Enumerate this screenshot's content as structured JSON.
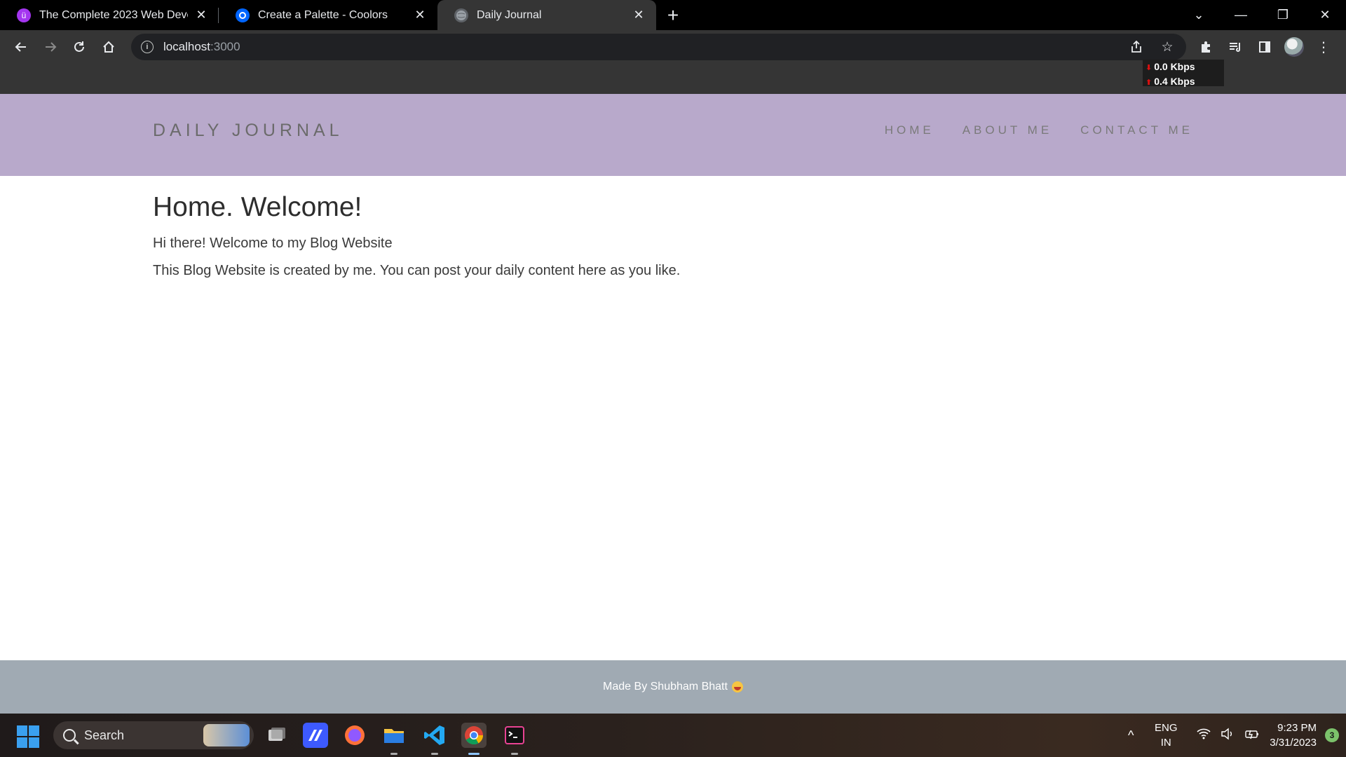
{
  "browser": {
    "tabs": [
      {
        "title": "The Complete 2023 Web Develop",
        "icon": "udemy-icon",
        "active": false
      },
      {
        "title": "Create a Palette - Coolors",
        "icon": "coolors-icon",
        "active": false
      },
      {
        "title": "Daily Journal",
        "icon": "globe-icon",
        "active": true
      }
    ],
    "new_tab_label": "+",
    "address": {
      "host": "localhost",
      "port": ":3000"
    },
    "net_meter": {
      "down": "0.0 Kbps",
      "up": "0.4 Kbps"
    }
  },
  "site": {
    "brand": "DAILY JOURNAL",
    "nav": [
      "HOME",
      "ABOUT ME",
      "CONTACT ME"
    ],
    "heading": "Home. Welcome!",
    "paragraphs": [
      "Hi there! Welcome to my Blog Website",
      "This Blog Website is created by me. You can post your daily content here as you like."
    ],
    "footer": "Made By Shubham Bhatt",
    "colors": {
      "header_bg": "#b8a9cb",
      "footer_bg": "#a0aab3"
    }
  },
  "taskbar": {
    "search_label": "Search",
    "apps": [
      "task-view",
      "screen-app",
      "firefox",
      "file-explorer",
      "vs-code",
      "chrome",
      "terminal"
    ],
    "language": {
      "line1": "ENG",
      "line2": "IN"
    },
    "time": "9:23 PM",
    "date": "3/31/2023",
    "notifications": "3"
  }
}
